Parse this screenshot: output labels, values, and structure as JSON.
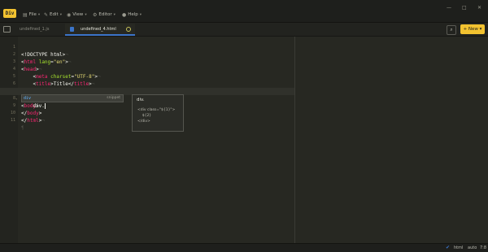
{
  "app": {
    "logo_text": "Div",
    "menus": [
      {
        "label": "File",
        "icon": "file-icon"
      },
      {
        "label": "Edit",
        "icon": "pencil-icon"
      },
      {
        "label": "View",
        "icon": "eye-icon"
      },
      {
        "label": "Editor",
        "icon": "gear-icon"
      },
      {
        "label": "Help",
        "icon": "help-icon"
      }
    ],
    "window_controls": [
      "—",
      "□",
      "✕"
    ]
  },
  "tabs": [
    {
      "label": "undefined_1.js",
      "active": false
    },
    {
      "label": "undefined_4.html",
      "active": true,
      "dirty": true
    }
  ],
  "toolbar": {
    "search_icon": "search-icon",
    "new_label": "New",
    "new_plus": "+",
    "new_caret": "▾"
  },
  "editor": {
    "lines": [
      {
        "n": "1",
        "fold": ""
      },
      {
        "n": "2",
        "fold": ""
      },
      {
        "n": "3",
        "fold": ""
      },
      {
        "n": "4",
        "fold": ""
      },
      {
        "n": "5",
        "fold": ""
      },
      {
        "n": "6",
        "fold": ""
      },
      {
        "n": "7",
        "fold": "▾"
      },
      {
        "n": "8",
        "fold": ""
      },
      {
        "n": "9",
        "fold": ""
      },
      {
        "n": "10",
        "fold": ""
      },
      {
        "n": "11",
        "fold": ""
      }
    ],
    "current_line": 8
  },
  "autocomplete": {
    "item": "div",
    "type": "snippet",
    "doc_title": "div.",
    "doc_body": "<div class=\"${1}\">\n    ${2}\n</div>"
  },
  "status": {
    "language": "html",
    "mode": "auto",
    "position": "7:8",
    "colors": {
      "accent": "#f2c230",
      "tab_active": "#3b74c8"
    }
  }
}
